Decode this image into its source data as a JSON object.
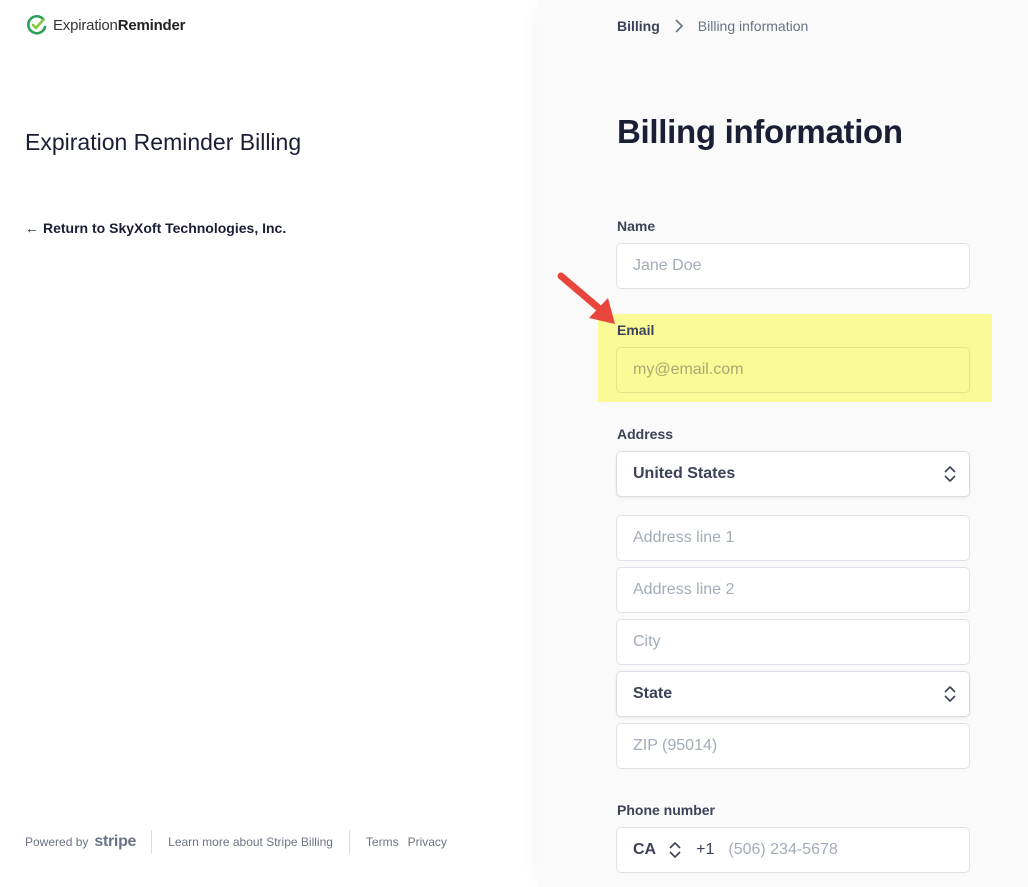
{
  "brand": {
    "logo_text_light": "Expiration",
    "logo_text_bold": "Reminder",
    "logo_color": "#2e9e5b"
  },
  "left": {
    "title": "Expiration Reminder Billing",
    "return_link": "Return to SkyXoft Technologies, Inc.",
    "footer": {
      "powered_by": "Powered by",
      "stripe": "stripe",
      "learn_more": "Learn more about Stripe Billing",
      "terms": "Terms",
      "privacy": "Privacy"
    }
  },
  "breadcrumb": {
    "parent": "Billing",
    "current": "Billing information"
  },
  "form": {
    "title": "Billing information",
    "name": {
      "label": "Name",
      "placeholder": "Jane Doe"
    },
    "email": {
      "label": "Email",
      "placeholder": "my@email.com"
    },
    "address": {
      "label": "Address",
      "country": "United States",
      "line1_placeholder": "Address line 1",
      "line2_placeholder": "Address line 2",
      "city_placeholder": "City",
      "state": "State",
      "zip_placeholder": "ZIP (95014)"
    },
    "phone": {
      "label": "Phone number",
      "country_code": "CA",
      "dial_code": "+1",
      "placeholder": "(506) 234-5678"
    }
  },
  "annotation": {
    "highlight_color": "#fafa96",
    "arrow_color": "#e8453c"
  }
}
